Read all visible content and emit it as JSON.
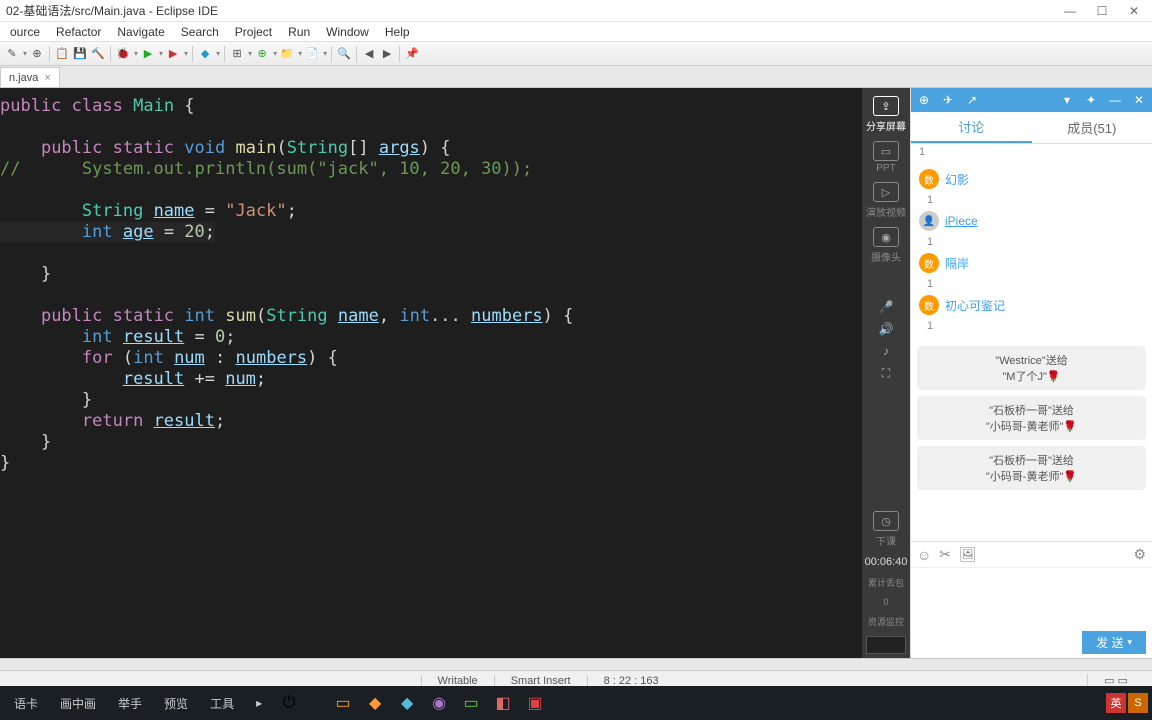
{
  "titlebar": {
    "title": "02-基础语法/src/Main.java - Eclipse IDE"
  },
  "menu": {
    "items": [
      "ource",
      "Refactor",
      "Navigate",
      "Search",
      "Project",
      "Run",
      "Window",
      "Help"
    ]
  },
  "editor": {
    "tab": {
      "name": "n.java",
      "close": "×"
    }
  },
  "code": {
    "l1a": "public",
    "l1b": "class",
    "l1c": "Main",
    "l1d": " {",
    "l2a": "public",
    "l2b": "static",
    "l2c": "void",
    "l2d": "main",
    "l2e": "String",
    "l2f": "args",
    "l2g": ") {",
    "l2h": "[] ",
    "l3a": "//",
    "l3b": "System.out.println(sum(\"jack\", 10, 20, 30));",
    "l4a": "String",
    "l4b": "name",
    "l4c": " = ",
    "l4d": "\"Jack\"",
    "l4e": ";",
    "l5a": "int",
    "l5b": "age",
    "l5c": " = ",
    "l5d": "20",
    "l5e": ";",
    "l6": "    }",
    "l7a": "public",
    "l7b": "static",
    "l7c": "int",
    "l7d": "sum",
    "l7e": "String",
    "l7f": "name",
    "l7g": "int",
    "l7h": "numbers",
    "l7i": ") {",
    "l8a": "int",
    "l8b": "result",
    "l8c": " = ",
    "l8d": "0",
    "l8e": ";",
    "l9a": "for",
    "l9b": " (",
    "l9c": "int",
    "l9d": "num",
    "l9e": " : ",
    "l9f": "numbers",
    "l9g": ") {",
    "l10a": "result",
    "l10b": " += ",
    "l10c": "num",
    "l10d": ";",
    "l11": "        }",
    "l12a": "return",
    "l12b": "result",
    "l12c": ";",
    "l13": "    }",
    "l14": "}"
  },
  "strip": {
    "share": "分享屏幕",
    "ppt": "PPT",
    "play": "演放视频",
    "cam": "摄像头",
    "mic": "",
    "vol": "",
    "music": "",
    "expand": "",
    "timer_icon": "下课",
    "time": "00:06:40",
    "acc": "累计丢包",
    "pct": "0",
    "res": "资源监控"
  },
  "chat": {
    "tabs": {
      "discuss": "讨论",
      "members": "成员(51)"
    },
    "participants": [
      {
        "badge": "数",
        "name": "幻影",
        "count": "1"
      },
      {
        "badge": "",
        "name": "iPiece",
        "count": "1"
      },
      {
        "badge": "数",
        "name": "隔岸",
        "count": "1"
      },
      {
        "badge": "数",
        "name": "初心可鉴记",
        "count": "1"
      }
    ],
    "top_count": "1",
    "messages": [
      {
        "line1": "\"Westrice\"送给",
        "line2": "\"M了个J\"🌹"
      },
      {
        "line1": "\"石板桥一哥\"送给",
        "line2": "\"小码哥-黄老师\"🌹"
      },
      {
        "line1": "\"石板桥一哥\"送给",
        "line2": "\"小码哥-黄老师\"🌹"
      }
    ],
    "send": "发 送"
  },
  "status": {
    "writable": "Writable",
    "insert": "Smart Insert",
    "pos": "8 : 22 : 163"
  },
  "taskbar": {
    "items": [
      "语卡",
      "画中画",
      "举手",
      "预览",
      "工具"
    ],
    "ime1": "英",
    "ime2": "S"
  }
}
